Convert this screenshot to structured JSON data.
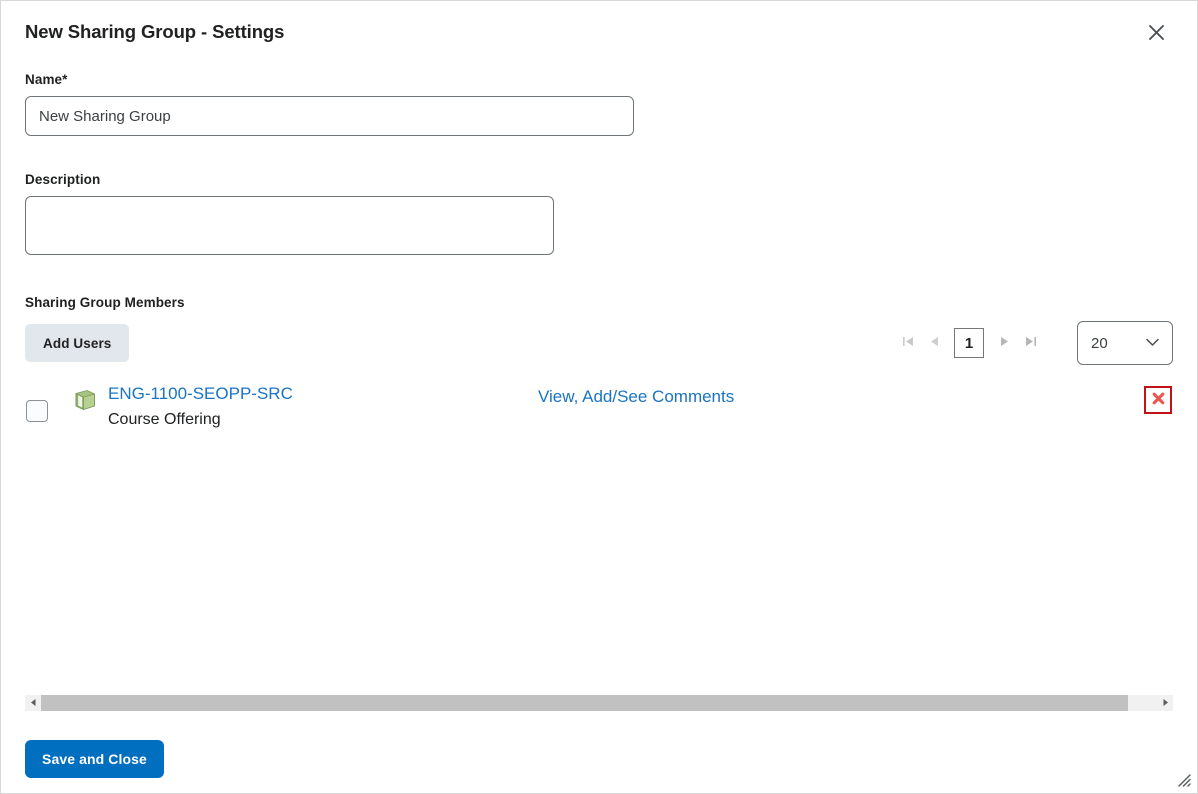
{
  "dialog": {
    "title": "New Sharing Group - Settings",
    "close_icon": "close-icon"
  },
  "form": {
    "name": {
      "label": "Name",
      "required_marker": "*",
      "value": "New Sharing Group",
      "placeholder": ""
    },
    "description": {
      "label": "Description",
      "value": "",
      "placeholder": ""
    }
  },
  "members_section": {
    "label": "Sharing Group Members",
    "add_users_label": "Add Users",
    "pagination": {
      "first_label": "First page",
      "prev_label": "Previous page",
      "current_page": "1",
      "next_label": "Next page",
      "last_label": "Last page"
    },
    "page_size": {
      "value": "20",
      "chevron_icon": "chevron-down-icon"
    },
    "rows": [
      {
        "checkbox_checked": false,
        "icon": "course-book-icon",
        "name": "ENG-1100-SEOPP-SRC",
        "type": "Course Offering",
        "comments_link": "View, Add/See Comments",
        "delete_label": "Remove"
      }
    ]
  },
  "scrollbar": {
    "left_arrow": "triangle-left-icon",
    "right_arrow": "triangle-right-icon"
  },
  "footer": {
    "save_label": "Save and Close",
    "resize_grip": "resize-grip-icon"
  },
  "colors": {
    "primary": "#006fbf",
    "link": "#1a73c4",
    "danger_border": "#c3131a",
    "danger_glyph": "#ef5350",
    "secondary_bg": "#e2e7ed",
    "book_green": "#8fb36a"
  }
}
